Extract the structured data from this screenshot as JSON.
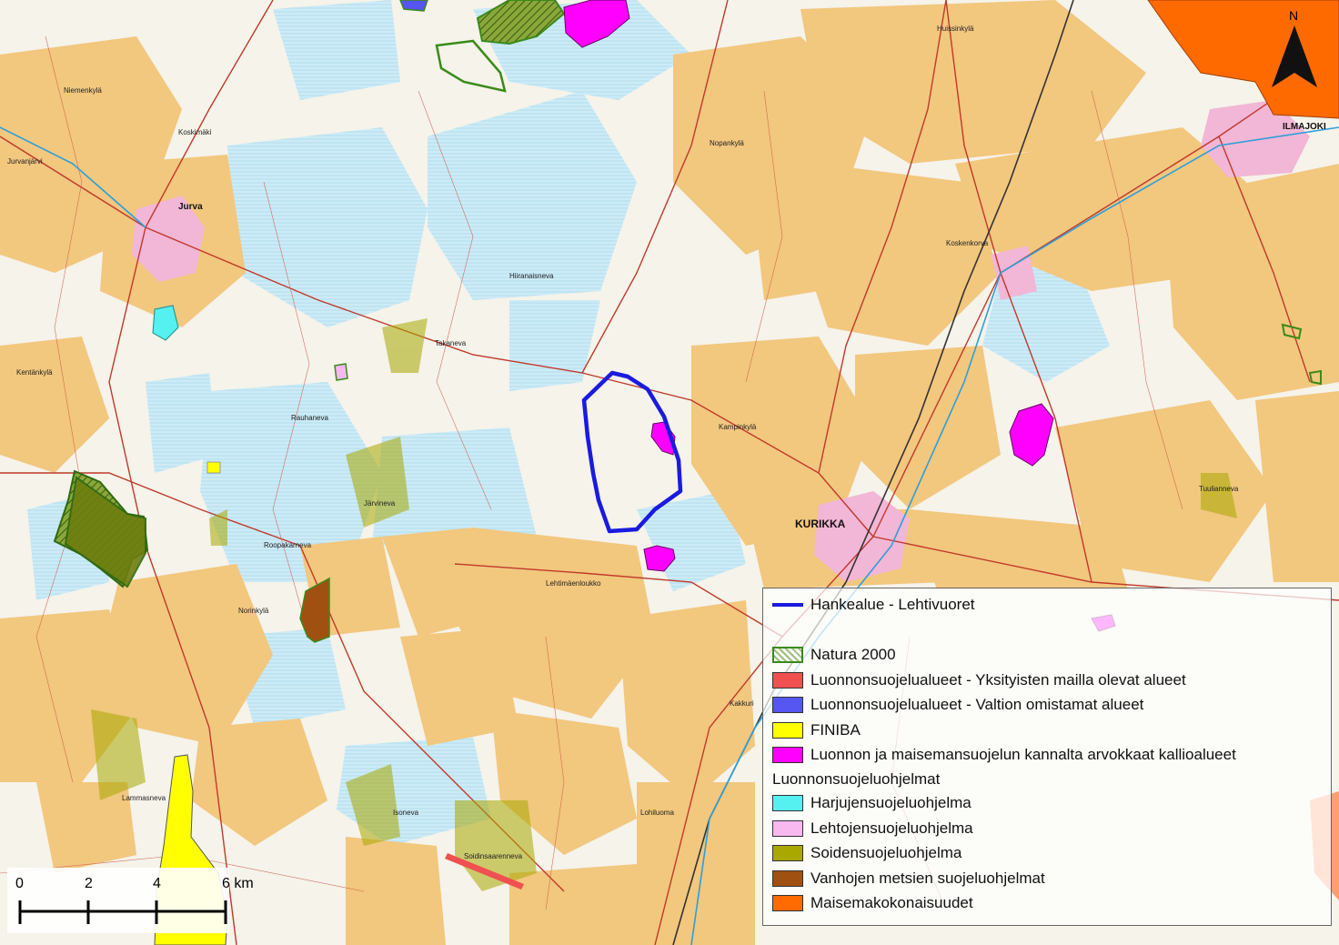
{
  "map": {
    "places": {
      "jurva": "Jurva",
      "kurikka": "KURIKKA",
      "ilmajoki": "ILMAJOKI",
      "niemenkyla": "Niemenkylä",
      "koskimaki": "Koskimäki",
      "jurvanjarvi": "Jurvanjärvi",
      "kentankyla": "Kentänkylä",
      "rauhaneva": "Rauhaneva",
      "jarvineva": "Järvineva",
      "roopakarneva": "Roopakarneva",
      "hiiranaisneva": "Hiiranaisneva",
      "takaneva": "Takaneva",
      "nopankyla": "Nopankylä",
      "huissinkyla": "Huissinkylä",
      "koskenkorva": "Koskenkorva",
      "kampinkyla": "Kampinkylä",
      "isoneva": "Isoneva",
      "lammasneva": "Lammasneva",
      "nurmijarvi": "Norinkylä",
      "lohiluoma": "Lohiluoma",
      "mustasaari": "Lehtimäenloukko",
      "kakkuri": "Kakkuri",
      "tuulianneva": "Tuulianneva",
      "soidinsaarenneva": "Soidinsaarenneva"
    },
    "north_arrow_label": "N",
    "colors": {
      "farmland": "#f2c77e",
      "forest": "#f6f4ea",
      "mire": "#bfe6f4",
      "urban": "#f1b8d8",
      "road": "#c0392b",
      "project_boundary": "#1a1ae0",
      "natura": "#3a8a1a",
      "finiba": "#ffff00",
      "rock_areas": "#ff00ff",
      "landscape": "#ff6a00",
      "mire_program": "#6e7d0f"
    }
  },
  "scale_bar": {
    "ticks": [
      "0",
      "2",
      "4",
      "6 km"
    ]
  },
  "legend": {
    "items": [
      {
        "label": "Hankealue - Lehtivuoret",
        "symbol": "line",
        "color": "#1a1ae0"
      },
      {
        "label": "",
        "symbol": "blank"
      },
      {
        "label": "Natura 2000",
        "symbol": "hatch",
        "color": "#3a8a1a"
      },
      {
        "label": "Luonnonsuojelualueet - Yksityisten mailla olevat alueet",
        "symbol": "fill",
        "color": "#f05050"
      },
      {
        "label": "Luonnonsuojelualueet - Valtion omistamat alueet",
        "symbol": "fill",
        "color": "#5555f0"
      },
      {
        "label": "FINIBA",
        "symbol": "fill",
        "color": "#ffff00"
      },
      {
        "label": "Luonnon ja maisemansuojelun kannalta arvokkaat kallioalueet",
        "symbol": "fill",
        "color": "#ff00ff"
      }
    ],
    "subheading": "Luonnonsuojeluohjelmat",
    "program_items": [
      {
        "label": "Harjujensuojeluohjelma",
        "color": "#55f0f0"
      },
      {
        "label": "Lehtojensuojeluohjelma",
        "color": "#f8b8f0"
      },
      {
        "label": "Soidensuojeluohjelma",
        "color": "#a8a800"
      },
      {
        "label": "Vanhojen metsien suojeluohjelmat",
        "color": "#a05010"
      },
      {
        "label": "Maisemakokonaisuudet",
        "color": "#ff6a00"
      }
    ]
  }
}
